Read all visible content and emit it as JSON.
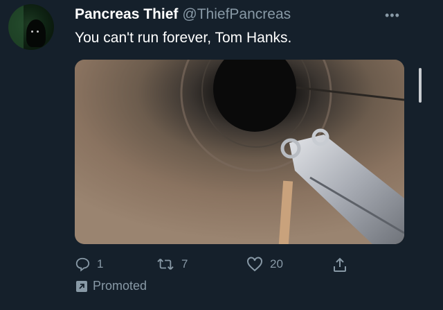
{
  "tweet": {
    "author_name": "Pancreas Thief",
    "author_handle": "@ThiefPancreas",
    "more_label": "•••",
    "text": "You can't run forever, Tom Hanks.",
    "media_description_icon": "photo",
    "actions": {
      "reply_count": "1",
      "retweet_count": "7",
      "like_count": "20"
    },
    "promoted_label": "Promoted"
  },
  "colors": {
    "background": "#15202b",
    "primary_text": "#ffffff",
    "secondary_text": "#8899a6"
  },
  "icons": {
    "reply": "reply-icon",
    "retweet": "retweet-icon",
    "like": "heart-icon",
    "share": "share-icon",
    "promoted": "promoted-arrow-icon",
    "more": "more-options-icon"
  }
}
